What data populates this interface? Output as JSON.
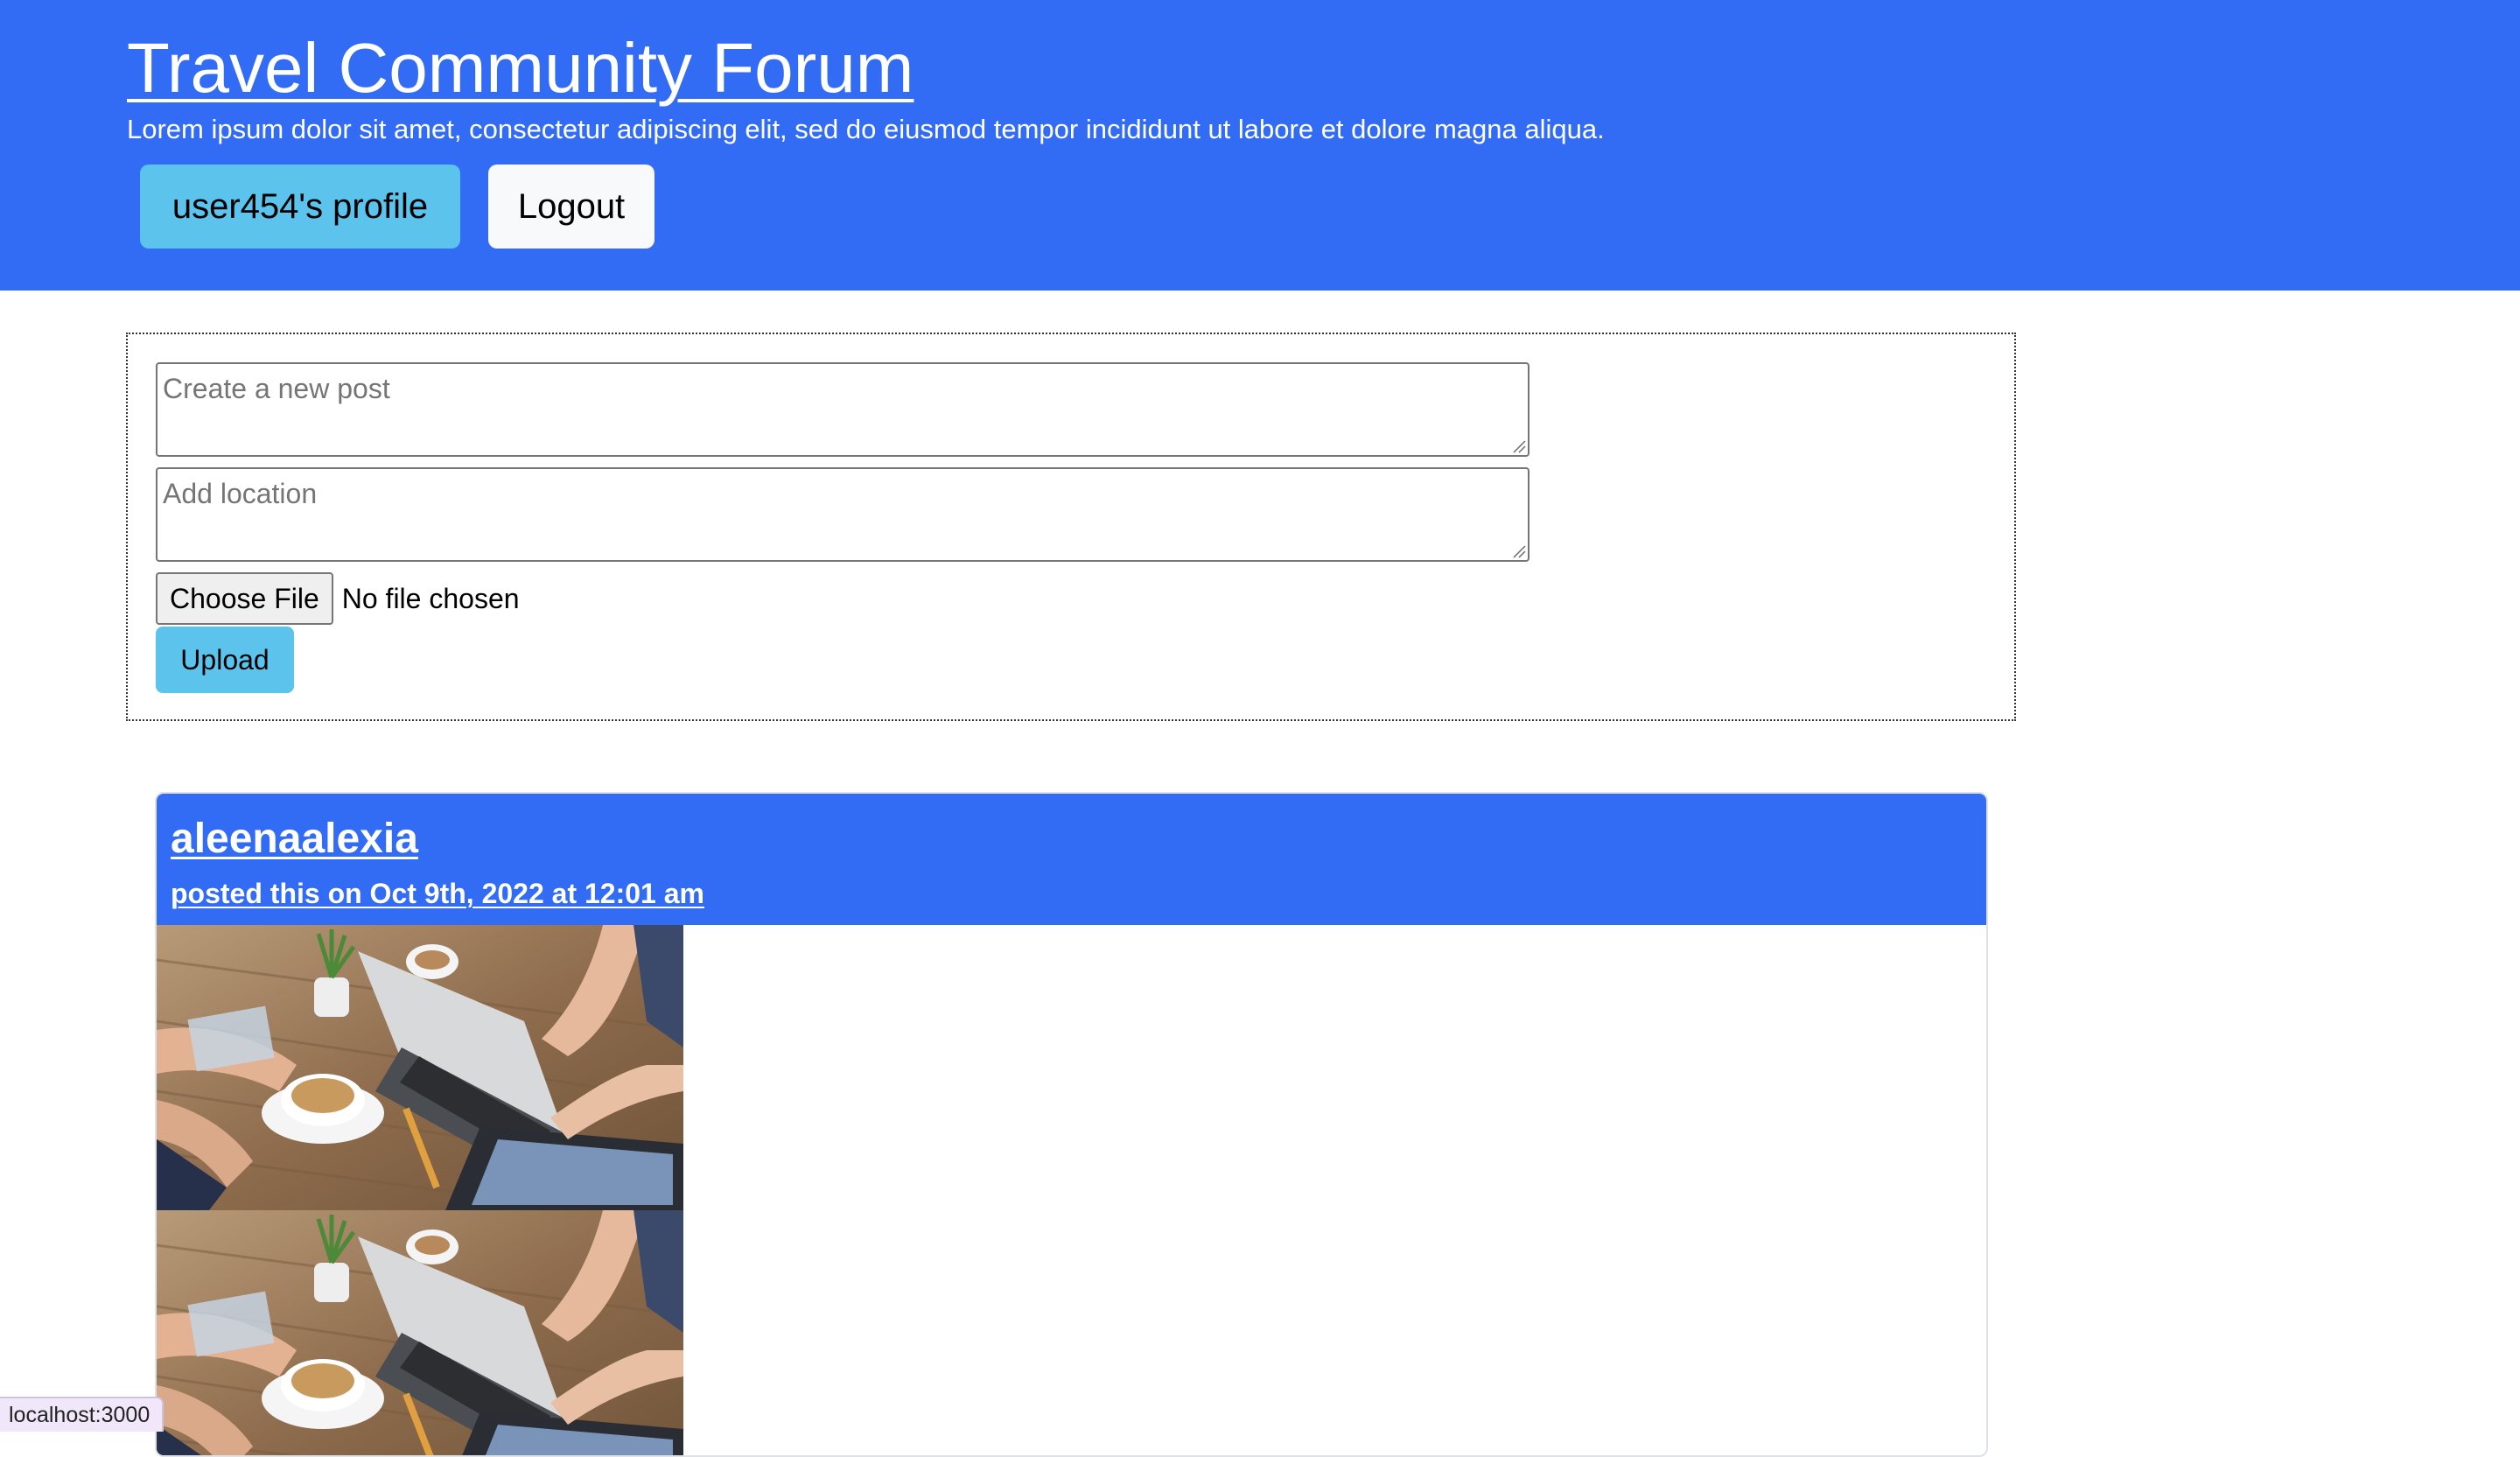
{
  "header": {
    "title": "Travel Community Forum",
    "subtitle": "Lorem ipsum dolor sit amet, consectetur adipiscing elit, sed do eiusmod tempor incididunt ut labore et dolore magna aliqua.",
    "profile_button": "user454's profile",
    "logout_button": "Logout",
    "background_color": "#336cf4"
  },
  "post_form": {
    "post_placeholder": "Create a new post",
    "location_placeholder": "Add location",
    "choose_file_label": "Choose File",
    "file_status": "No file chosen",
    "upload_label": "Upload"
  },
  "posts": [
    {
      "author": "aleenaalexia",
      "posted": "posted this on Oct 9th, 2022 at 12:01 am",
      "images": [
        "coworking-desk-laptops-coffee-photo",
        "coworking-desk-laptops-coffee-photo"
      ]
    }
  ],
  "status_bar": {
    "url": "localhost:3000"
  },
  "colors": {
    "primary_blue": "#336cf4",
    "info_button": "#5bc3ec",
    "light_button": "#f8f9fa"
  }
}
